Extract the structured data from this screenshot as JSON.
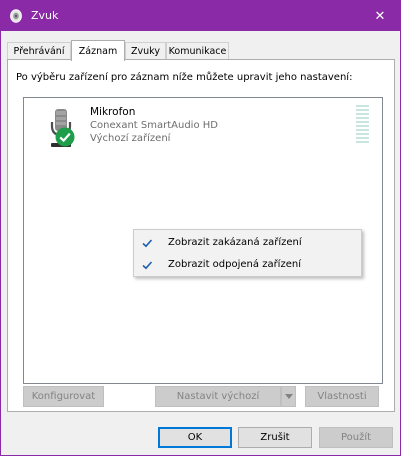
{
  "window": {
    "title": "Zvuk",
    "titlebar_color": "#8a2aa6",
    "close_glyph": "✕"
  },
  "tabs": [
    {
      "label": "Přehrávání",
      "active": false
    },
    {
      "label": "Záznam",
      "active": true
    },
    {
      "label": "Zvuky",
      "active": false
    },
    {
      "label": "Komunikace",
      "active": false
    }
  ],
  "instruction": "Po výběru zařízení pro záznam níže můžete upravit jeho nastavení:",
  "device": {
    "name": "Mikrofon",
    "driver": "Conexant SmartAudio HD",
    "status": "Výchozí zařízení",
    "icon": "microphone-icon",
    "badge_icon": "default-check-icon",
    "badge_color": "#1e9e4a",
    "level_color": "#c8e6de"
  },
  "context_menu": [
    {
      "label": "Zobrazit zakázaná zařízení",
      "checked": true
    },
    {
      "label": "Zobrazit odpojená zařízení",
      "checked": true
    }
  ],
  "panel_buttons": {
    "configure": "Konfigurovat",
    "set_default": "Nastavit výchozí",
    "properties": "Vlastnosti"
  },
  "dialog_buttons": {
    "ok": "OK",
    "cancel": "Zrušit",
    "apply": "Použít"
  },
  "accent_color": "#0078d7"
}
